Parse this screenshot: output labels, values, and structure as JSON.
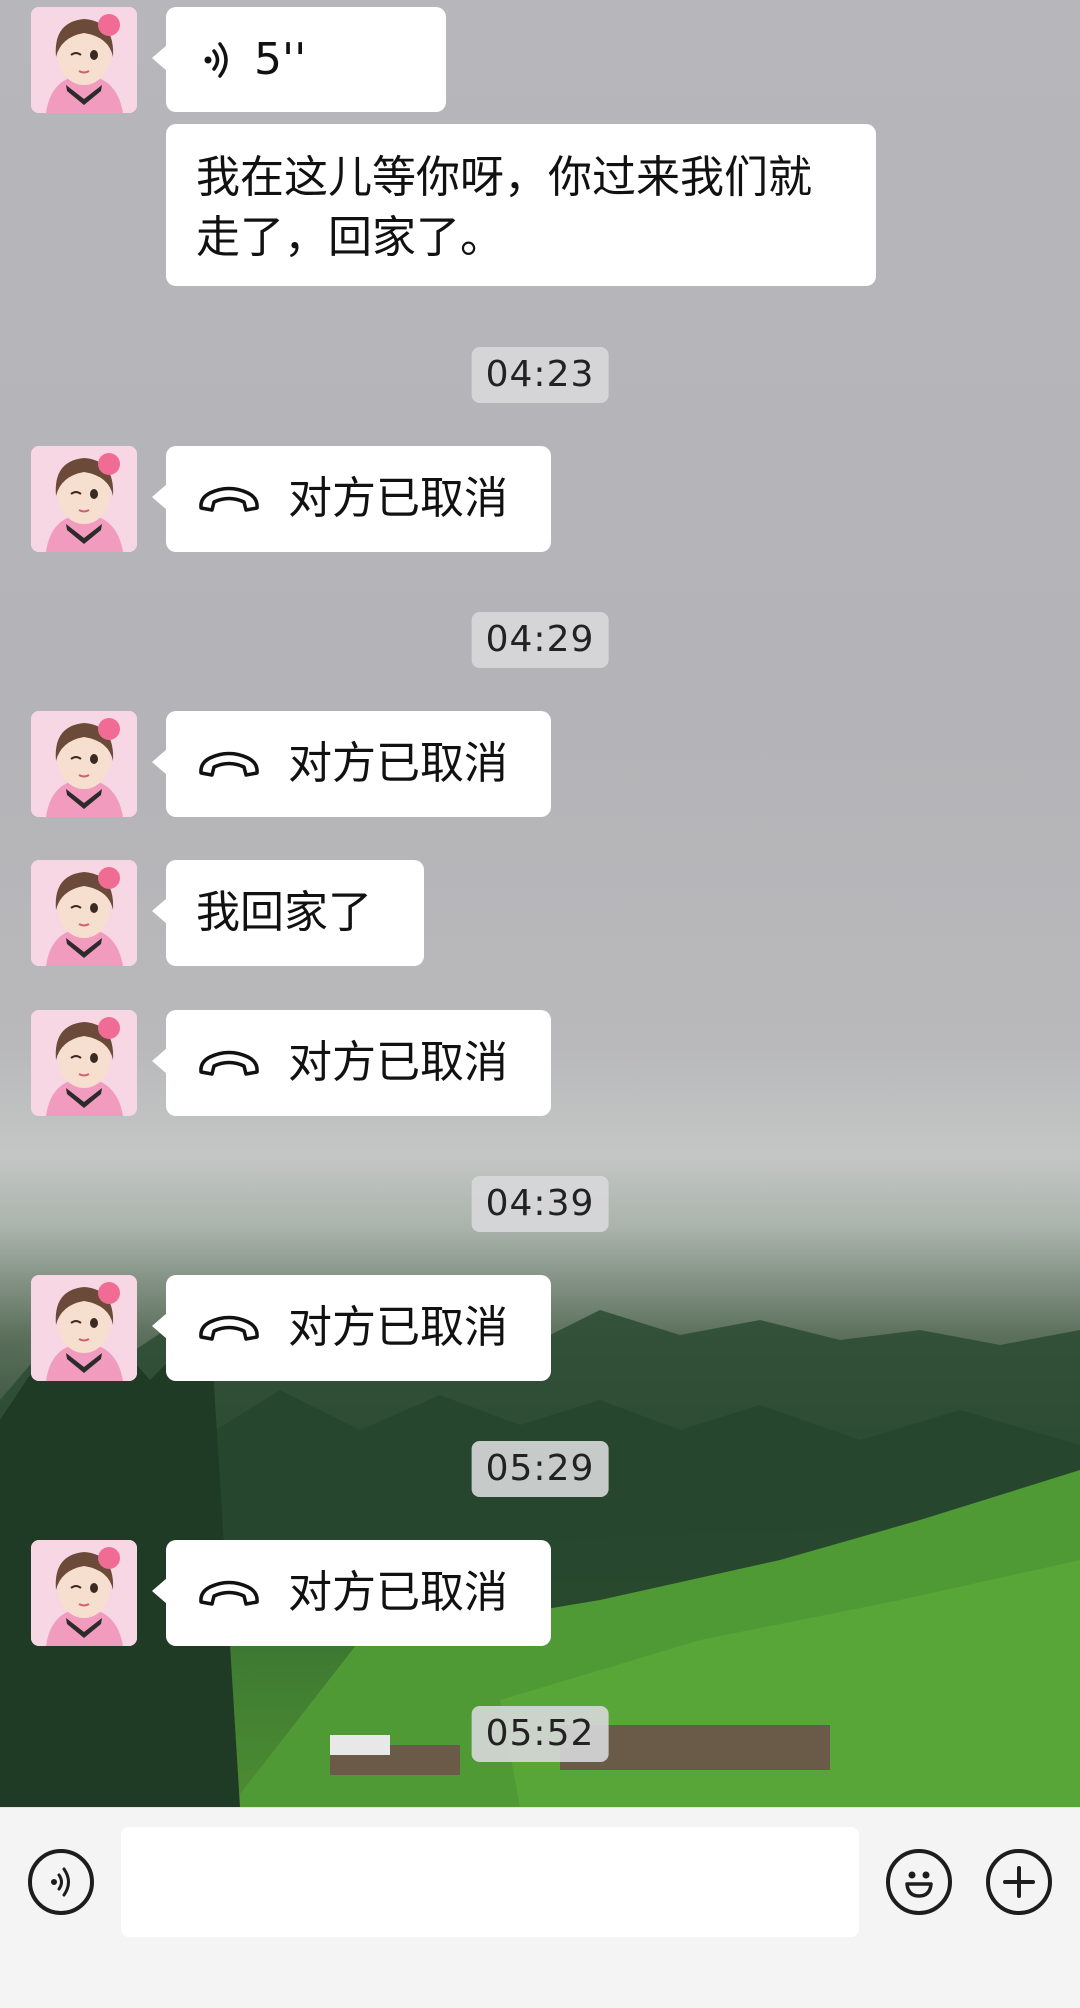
{
  "messages": {
    "voice_duration": "5''",
    "text1": "我在这儿等你呀，你过来我们就走了，回家了。",
    "call_cancel_1": "对方已取消",
    "call_cancel_2": "对方已取消",
    "text2": "我回家了",
    "call_cancel_3": "对方已取消",
    "call_cancel_4": "对方已取消",
    "call_cancel_5": "对方已取消"
  },
  "timestamps": [
    "04:23",
    "04:29",
    "04:39",
    "05:29",
    "05:52"
  ],
  "colors": {
    "bubble": "#ffffff",
    "timestamp_bg": "#d8d8da",
    "input_bar": "#f4f4f4"
  },
  "icons": [
    "voice-wave-icon",
    "phone-hangup-icon",
    "voice-input-icon",
    "emoji-icon",
    "plus-icon"
  ]
}
